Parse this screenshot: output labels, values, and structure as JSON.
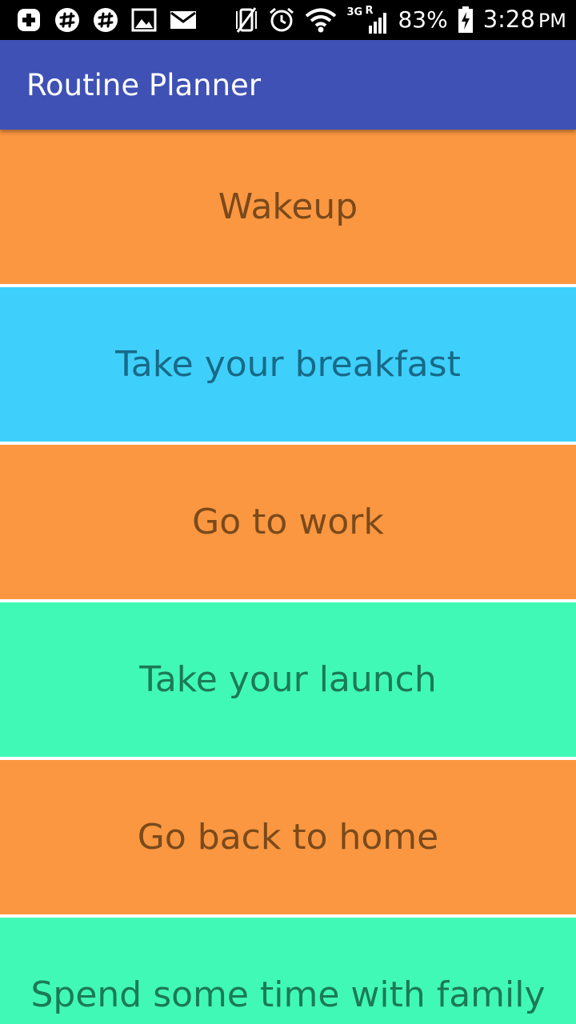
{
  "status_bar": {
    "battery_percent": "83%",
    "time": "3:28",
    "ampm": "PM",
    "network_type": "3G",
    "roaming": "R",
    "icons": [
      "plus-icon",
      "slack-icon",
      "slack-icon",
      "image-icon",
      "mail-icon",
      "vibrate-off-icon",
      "alarm-icon",
      "wifi-icon",
      "signal-icon",
      "battery-charging-icon"
    ]
  },
  "app_bar": {
    "title": "Routine Planner",
    "color": "#3f51b5"
  },
  "routine": {
    "items": [
      {
        "label": "Wakeup",
        "bg": "#fb9740",
        "fg": "#7a4a1c"
      },
      {
        "label": "Take your breakfast",
        "bg": "#3ed0fb",
        "fg": "#186a88"
      },
      {
        "label": "Go to work",
        "bg": "#fb9740",
        "fg": "#7a4a1c"
      },
      {
        "label": "Take your launch",
        "bg": "#41f9b6",
        "fg": "#1c7a57"
      },
      {
        "label": "Go back to home",
        "bg": "#fb9740",
        "fg": "#7a4a1c"
      },
      {
        "label": "Spend some time with family",
        "bg": "#41f9b6",
        "fg": "#1c7a57"
      }
    ]
  }
}
